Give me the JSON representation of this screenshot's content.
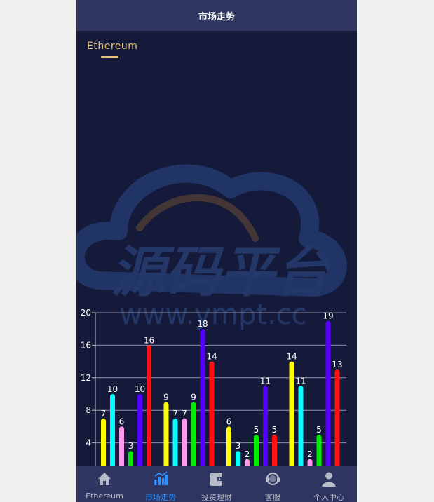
{
  "header": {
    "title": "市场走势"
  },
  "top_tab": {
    "label": "Ethereum"
  },
  "watermark": {
    "brand": "源码平台",
    "url": "www.ympt.cc"
  },
  "colors": {
    "accent": "#e6c37a",
    "nav_active": "#2c93ff",
    "nav_inactive": "#b8bcc8",
    "yellow": "#ffff00",
    "cyan": "#00ffff",
    "pink": "#ff99ee",
    "green": "#00ee00",
    "purple": "#5500ff",
    "red": "#ff1111"
  },
  "nav": [
    {
      "label": "Ethereum",
      "icon": "home-icon",
      "active": false
    },
    {
      "label": "市场走势",
      "icon": "chart-icon",
      "active": true
    },
    {
      "label": "投资理财",
      "icon": "wallet-icon",
      "active": false
    },
    {
      "label": "客服",
      "icon": "headset-icon",
      "active": false
    },
    {
      "label": "个人中心",
      "icon": "user-icon",
      "active": false
    }
  ],
  "chart_data": {
    "type": "bar",
    "title": "",
    "xlabel": "",
    "ylabel": "",
    "ylim": [
      0,
      20
    ],
    "yticks": [
      4,
      8,
      12,
      16,
      20
    ],
    "grid": true,
    "groups": [
      {
        "bars": [
          {
            "value": 7,
            "color": "#ffff00"
          },
          {
            "value": 10,
            "color": "#00ffff"
          },
          {
            "value": 6,
            "color": "#ff99ee"
          },
          {
            "value": 3,
            "color": "#00ee00"
          },
          {
            "value": 10,
            "color": "#5500ff"
          },
          {
            "value": 16,
            "color": "#ff1111"
          }
        ]
      },
      {
        "bars": [
          {
            "value": 9,
            "color": "#ffff00"
          },
          {
            "value": 7,
            "color": "#00ffff"
          },
          {
            "value": 7,
            "color": "#ff99ee"
          },
          {
            "value": 9,
            "color": "#00ee00"
          },
          {
            "value": 18,
            "color": "#5500ff"
          },
          {
            "value": 14,
            "color": "#ff1111"
          }
        ]
      },
      {
        "bars": [
          {
            "value": 6,
            "color": "#ffff00"
          },
          {
            "value": 3,
            "color": "#00ffff"
          },
          {
            "value": 2,
            "color": "#ff99ee"
          },
          {
            "value": 5,
            "color": "#00ee00"
          },
          {
            "value": 11,
            "color": "#5500ff"
          },
          {
            "value": 5,
            "color": "#ff1111"
          }
        ]
      },
      {
        "bars": [
          {
            "value": 14,
            "color": "#ffff00"
          },
          {
            "value": 11,
            "color": "#00ffff"
          },
          {
            "value": 2,
            "color": "#ff99ee"
          },
          {
            "value": 5,
            "color": "#00ee00"
          },
          {
            "value": 19,
            "color": "#5500ff"
          },
          {
            "value": 13,
            "color": "#ff1111"
          }
        ]
      }
    ]
  }
}
